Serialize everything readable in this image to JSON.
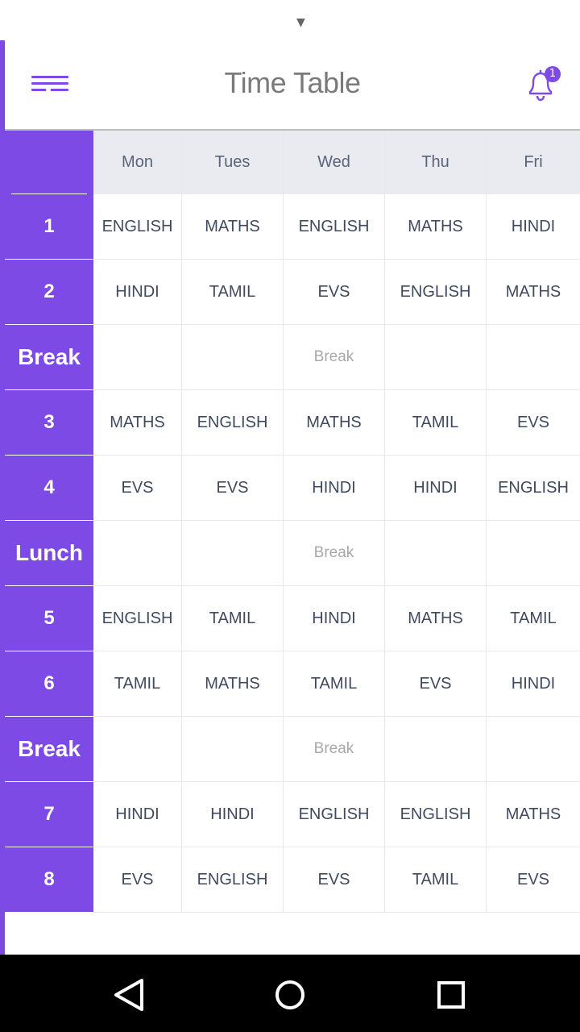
{
  "header": {
    "title": "Time Table",
    "notification_count": "1"
  },
  "days": [
    "Mon",
    "Tues",
    "Wed",
    "Thu",
    "Fri"
  ],
  "rows": [
    {
      "label": "1",
      "cells": [
        "ENGLISH",
        "MATHS",
        "ENGLISH",
        "MATHS",
        "HINDI"
      ]
    },
    {
      "label": "2",
      "cells": [
        "HINDI",
        "TAMIL",
        "EVS",
        "ENGLISH",
        "MATHS"
      ]
    },
    {
      "label": "Break",
      "cells": [
        "",
        "",
        "Break",
        "",
        ""
      ]
    },
    {
      "label": "3",
      "cells": [
        "MATHS",
        "ENGLISH",
        "MATHS",
        "TAMIL",
        "EVS"
      ]
    },
    {
      "label": "4",
      "cells": [
        "EVS",
        "EVS",
        "HINDI",
        "HINDI",
        "ENGLISH"
      ]
    },
    {
      "label": "Lunch",
      "cells": [
        "",
        "",
        "Break",
        "",
        ""
      ]
    },
    {
      "label": "5",
      "cells": [
        "ENGLISH",
        "TAMIL",
        "HINDI",
        "MATHS",
        "TAMIL"
      ]
    },
    {
      "label": "6",
      "cells": [
        "TAMIL",
        "MATHS",
        "TAMIL",
        "EVS",
        "HINDI"
      ]
    },
    {
      "label": "Break",
      "cells": [
        "",
        "",
        "Break",
        "",
        ""
      ]
    },
    {
      "label": "7",
      "cells": [
        "HINDI",
        "HINDI",
        "ENGLISH",
        "ENGLISH",
        "MATHS"
      ]
    },
    {
      "label": "8",
      "cells": [
        "EVS",
        "ENGLISH",
        "EVS",
        "TAMIL",
        "EVS"
      ]
    }
  ],
  "icons": {
    "menu": "hamburger-menu-icon",
    "notifications": "bell-icon",
    "back": "back-triangle-icon",
    "home": "home-circle-icon",
    "recents": "recents-square-icon"
  },
  "colors": {
    "accent": "#7d4ae6",
    "header_row_bg": "#e9ebf0",
    "cell_text": "#3f4a5e",
    "break_text": "#a8a8a8",
    "title_text": "#7a7a7a"
  }
}
